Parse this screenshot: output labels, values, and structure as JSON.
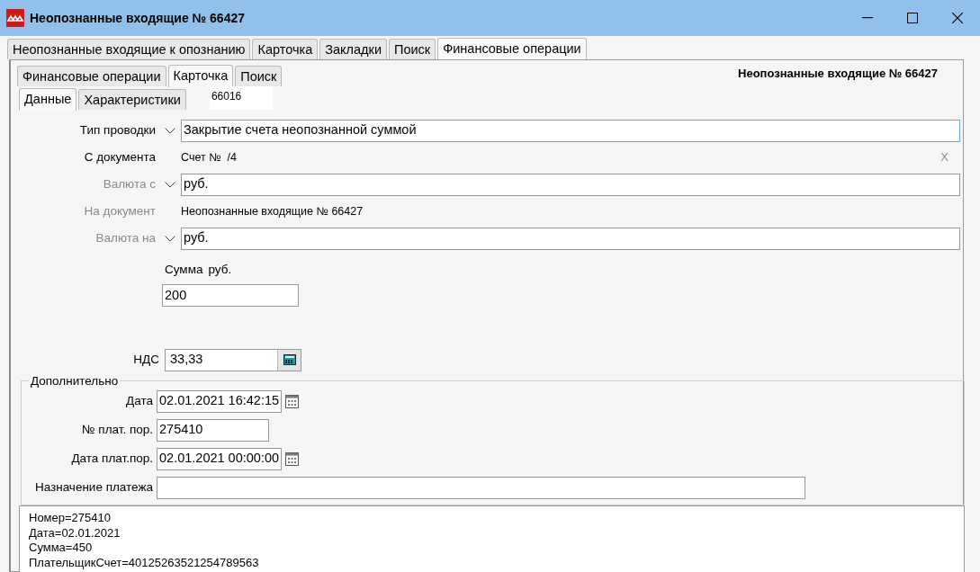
{
  "window": {
    "title": "Неопознанные входящие № 66427"
  },
  "main_tabs": [
    {
      "label": "Неопознанные входящие к опознанию",
      "selected": false
    },
    {
      "label": "Карточка",
      "selected": false
    },
    {
      "label": "Закладки",
      "selected": false
    },
    {
      "label": "Поиск",
      "selected": false
    },
    {
      "label": "Финансовые операции",
      "selected": true
    }
  ],
  "sub_tabs": [
    {
      "label": "Финансовые операции",
      "selected": false
    },
    {
      "label": "Карточка",
      "selected": true
    },
    {
      "label": "Поиск",
      "selected": false
    }
  ],
  "header_title": "Неопознанные входящие № 66427",
  "inner_tabs": [
    {
      "label": "Данные",
      "selected": true
    },
    {
      "label": "Характеристики",
      "selected": false
    }
  ],
  "record_id": "66016",
  "form_rows": [
    {
      "kind": "combo",
      "label": "Тип проводки",
      "value": "Закрытие счета неопознанной суммой",
      "disabled": false,
      "focused": true
    },
    {
      "kind": "link",
      "label": "С документа",
      "value": "Счет №  /4",
      "disabled": false,
      "clear": "X"
    },
    {
      "kind": "combo",
      "label": "Валюта с",
      "value": "руб.",
      "disabled": true,
      "focused": false
    },
    {
      "kind": "link",
      "label": "На документ",
      "value": "Неопознанные входящие № 66427",
      "disabled": true
    },
    {
      "kind": "combo",
      "label": "Валюта на",
      "value": "руб.",
      "disabled": true,
      "focused": false
    }
  ],
  "sum": {
    "label": "Сумма",
    "currency": "руб.",
    "value": "200"
  },
  "vat": {
    "label": "НДС",
    "value": "33,33"
  },
  "extra": {
    "legend": "Дополнительно",
    "fields": [
      {
        "kind": "date",
        "label": "Дата",
        "value": "02.01.2021 16:42:15"
      },
      {
        "kind": "text",
        "label": "№ плат. пор.",
        "value": "275410"
      },
      {
        "kind": "date",
        "label": "Дата плат.пор.",
        "value": "02.01.2021 00:00:00"
      },
      {
        "kind": "wide",
        "label": "Назначение платежа"
      }
    ]
  },
  "memo": [
    "Номер=275410",
    "Дата=02.01.2021",
    "Сумма=450",
    "ПлательщикСчет=40125263521254789563"
  ]
}
